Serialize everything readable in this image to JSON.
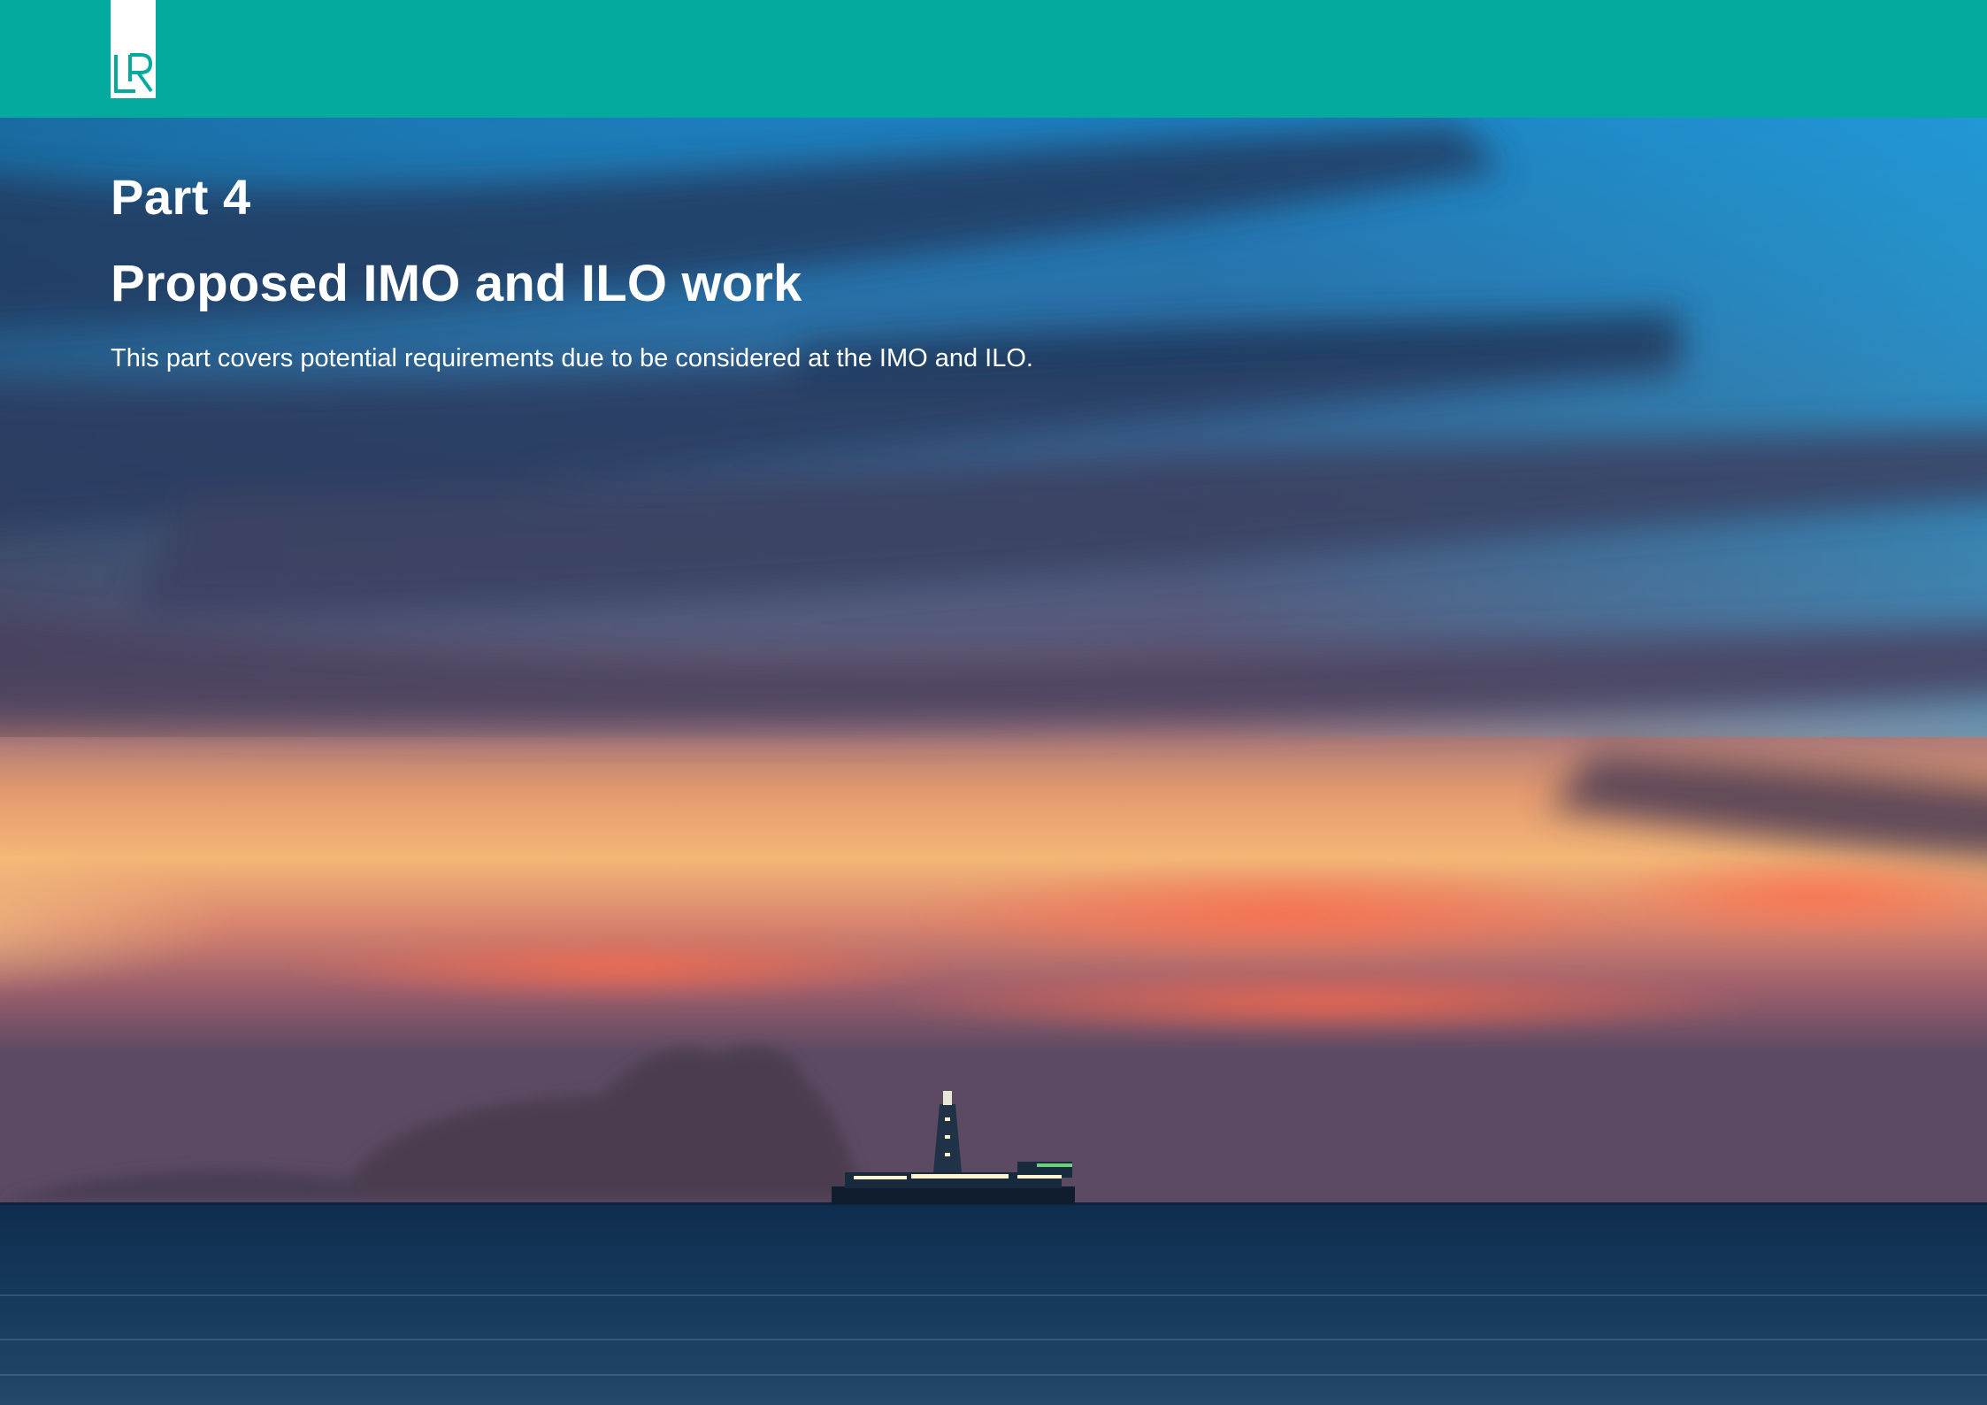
{
  "brand": {
    "logo_text": "LR",
    "header_color": "#05AA9F"
  },
  "section": {
    "part_label": "Part 4",
    "title": "Proposed IMO and ILO work",
    "description": "This part covers potential requirements due to be considered at the IMO and ILO."
  },
  "photo": {
    "subject": "drillship-at-sunset-photo"
  }
}
